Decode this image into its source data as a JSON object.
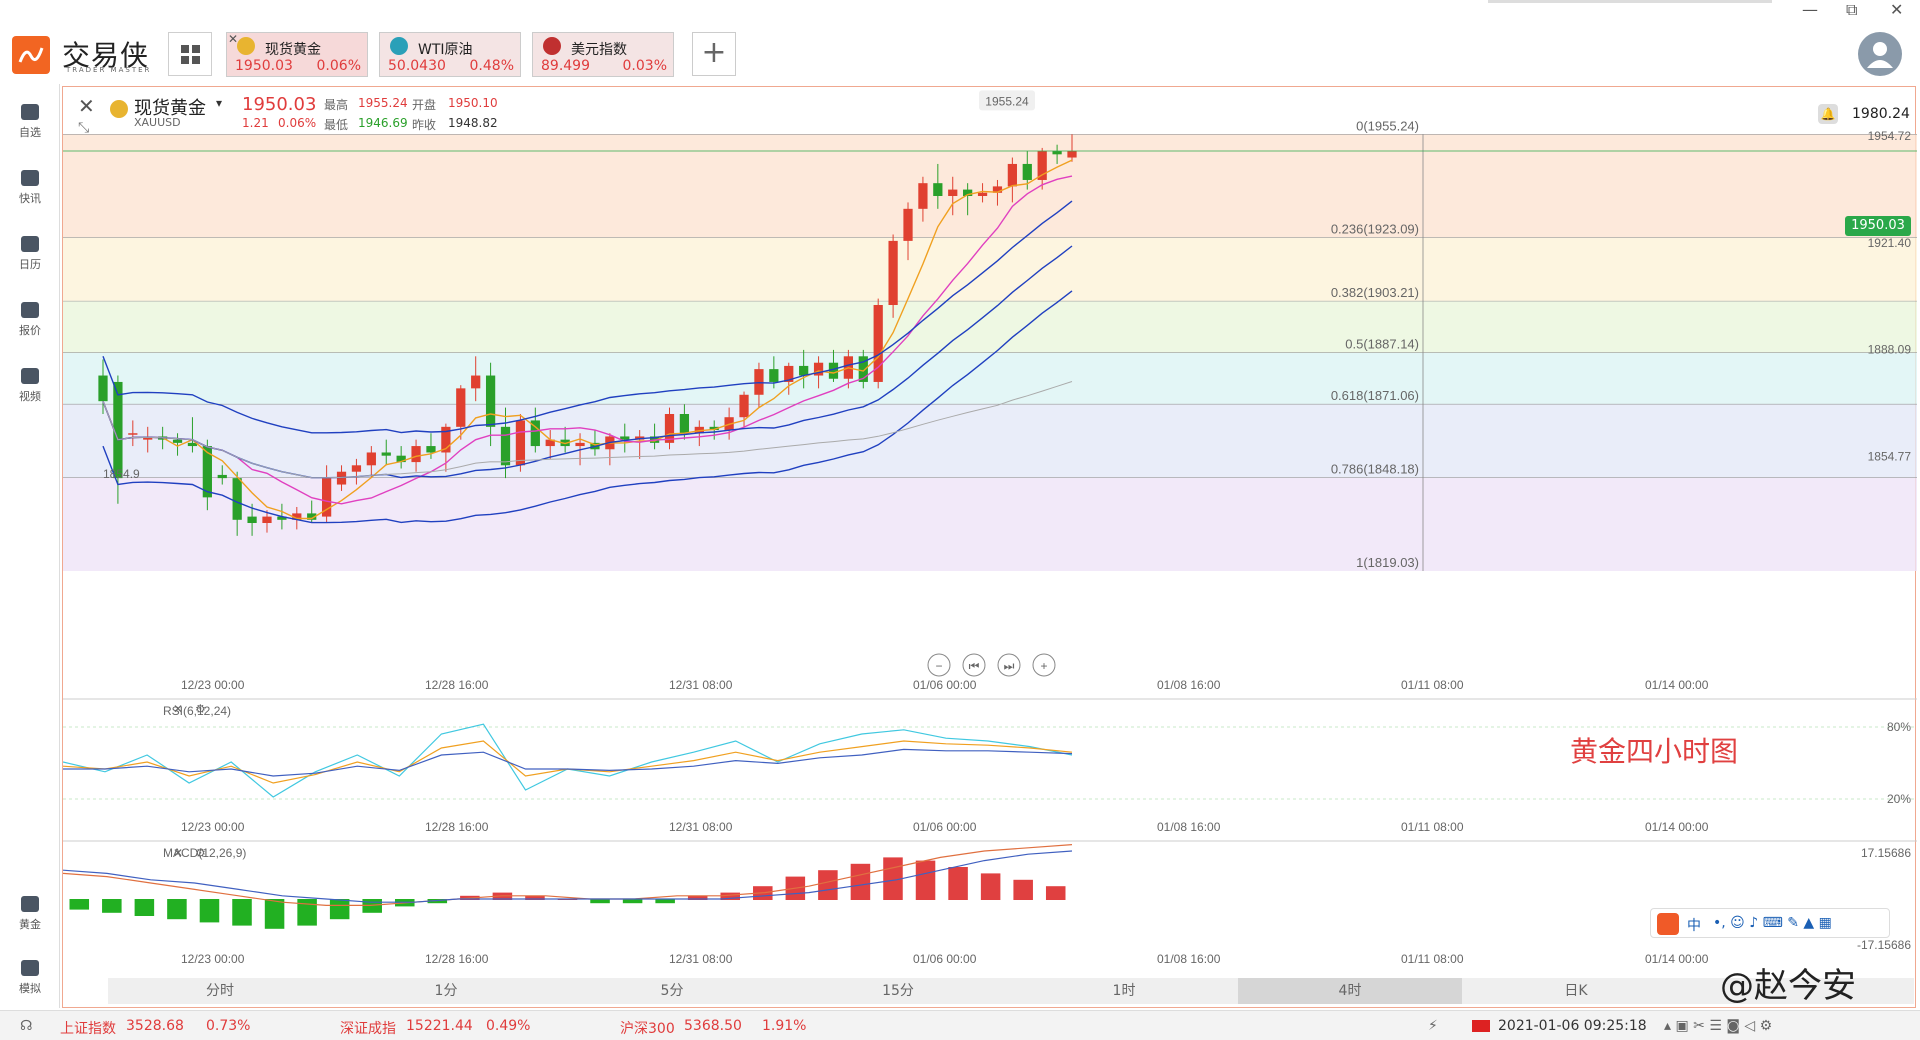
{
  "app": {
    "name": "交易侠",
    "subtitle": "TRADER MASTER"
  },
  "window": {
    "minimize": "—",
    "restore": "⧉",
    "close": "✕"
  },
  "tabs": [
    {
      "name": "现货黄金",
      "price": "1950.03",
      "change": "0.06%",
      "icon_color": "#e8b430",
      "active": true
    },
    {
      "name": "WTI原油",
      "price": "50.0430",
      "change": "0.48%",
      "icon_color": "#2aa0b8",
      "active": false
    },
    {
      "name": "美元指数",
      "price": "89.499",
      "change": "0.03%",
      "icon_color": "#c03030",
      "active": false
    }
  ],
  "add_label": "+",
  "sidebar": [
    {
      "label": "自选",
      "icon": "bookmark-icon"
    },
    {
      "label": "快讯",
      "icon": "news-icon"
    },
    {
      "label": "日历",
      "icon": "calendar-icon"
    },
    {
      "label": "报价",
      "icon": "quote-chart-icon"
    },
    {
      "label": "视频",
      "icon": "video-icon"
    },
    {
      "label": "黄金",
      "icon": "gold-icon"
    },
    {
      "label": "模拟",
      "icon": "simulate-icon"
    }
  ],
  "symbol": {
    "name": "现货黄金",
    "code": "XAUUSD",
    "price": "1950.03",
    "change": "1.21",
    "change_pct": "0.06%",
    "high_label": "最高",
    "high": "1955.24",
    "open_label": "开盘",
    "open": "1950.10",
    "low_label": "最低",
    "low": "1946.69",
    "prev_label": "昨收",
    "prev": "1948.82"
  },
  "alert_price": "1980.24",
  "current_price_tag": "1950.03",
  "peak_label": "1955.24",
  "low_marker": "1854.9",
  "fib": [
    {
      "label": "0(1955.24)",
      "color": "#fde3d2"
    },
    {
      "label": "0.236(1923.09)",
      "color": "#fdf3d8"
    },
    {
      "label": "0.382(1903.21)",
      "color": "#eaf6dc"
    },
    {
      "label": "0.5(1887.14)",
      "color": "#dcf4f4"
    },
    {
      "label": "0.618(1871.06)",
      "color": "#e4e8f8"
    },
    {
      "label": "0.786(1848.18)",
      "color": "#efe4f8"
    },
    {
      "label": "1(1819.03)",
      "color": "#ffffff"
    }
  ],
  "right_axis_main": [
    "1954.72",
    "1921.40",
    "1888.09",
    "1854.77"
  ],
  "x_labels": [
    "12/23 00:00",
    "12/28 16:00",
    "12/31 08:00",
    "01/06 00:00",
    "01/08 16:00",
    "01/11 08:00",
    "01/14 00:00"
  ],
  "rsi": {
    "label": "RSI(6,12,24)",
    "levels": [
      "80%",
      "20%"
    ]
  },
  "macd": {
    "label": "MACD(12,26,9)",
    "top": "17.15686",
    "bottom": "-17.15686"
  },
  "chart_tag": "黄金四小时图",
  "timeframes": [
    "分时",
    "1分",
    "5分",
    "15分",
    "1时",
    "4时",
    "日K"
  ],
  "active_timeframe": "4时",
  "status": [
    {
      "name": "上证指数",
      "value": "3528.68",
      "pct": "0.73%"
    },
    {
      "name": "深证成指",
      "value": "15221.44",
      "pct": "0.49%"
    },
    {
      "name": "沪深300",
      "value": "5368.50",
      "pct": "1.91%"
    }
  ],
  "datetime": "2021-01-06 09:25:18",
  "watermark": "@赵今安",
  "ime_label": "中",
  "chart_data": {
    "type": "candlestick",
    "candles": [
      [
        1880,
        1885,
        1868,
        1872
      ],
      [
        1878,
        1880,
        1840,
        1848
      ],
      [
        1862,
        1866,
        1858,
        1862
      ],
      [
        1860,
        1864,
        1856,
        1861
      ],
      [
        1861,
        1864,
        1857,
        1860
      ],
      [
        1860,
        1862,
        1855,
        1859
      ],
      [
        1859,
        1867,
        1856,
        1858
      ],
      [
        1858,
        1860,
        1838,
        1842
      ],
      [
        1849,
        1852,
        1846,
        1848
      ],
      [
        1848,
        1850,
        1830,
        1835
      ],
      [
        1836,
        1840,
        1830,
        1834
      ],
      [
        1834,
        1838,
        1831,
        1836
      ],
      [
        1836,
        1840,
        1832,
        1835
      ],
      [
        1835,
        1839,
        1832,
        1837
      ],
      [
        1837,
        1841,
        1834,
        1835
      ],
      [
        1836,
        1852,
        1834,
        1848
      ],
      [
        1846,
        1852,
        1844,
        1850
      ],
      [
        1850,
        1854,
        1846,
        1852
      ],
      [
        1852,
        1858,
        1848,
        1856
      ],
      [
        1856,
        1860,
        1852,
        1855
      ],
      [
        1855,
        1858,
        1851,
        1853
      ],
      [
        1853,
        1860,
        1850,
        1858
      ],
      [
        1858,
        1862,
        1854,
        1856
      ],
      [
        1856,
        1865,
        1850,
        1864
      ],
      [
        1864,
        1877,
        1860,
        1876
      ],
      [
        1876,
        1886,
        1872,
        1880
      ],
      [
        1880,
        1884,
        1858,
        1864
      ],
      [
        1864,
        1870,
        1848,
        1852
      ],
      [
        1852,
        1868,
        1850,
        1866
      ],
      [
        1866,
        1870,
        1856,
        1858
      ],
      [
        1858,
        1863,
        1854,
        1860
      ],
      [
        1860,
        1864,
        1856,
        1858
      ],
      [
        1858,
        1862,
        1852,
        1859
      ],
      [
        1859,
        1863,
        1855,
        1857
      ],
      [
        1857,
        1862,
        1852,
        1861
      ],
      [
        1861,
        1865,
        1856,
        1860
      ],
      [
        1860,
        1863,
        1854,
        1861
      ],
      [
        1861,
        1865,
        1857,
        1859
      ],
      [
        1859,
        1870,
        1857,
        1868
      ],
      [
        1868,
        1871,
        1860,
        1862
      ],
      [
        1862,
        1866,
        1858,
        1864
      ],
      [
        1864,
        1866,
        1860,
        1863
      ],
      [
        1863,
        1870,
        1860,
        1867
      ],
      [
        1867,
        1875,
        1864,
        1874
      ],
      [
        1874,
        1884,
        1870,
        1882
      ],
      [
        1882,
        1886,
        1876,
        1878
      ],
      [
        1878,
        1884,
        1874,
        1883
      ],
      [
        1883,
        1888,
        1876,
        1880
      ],
      [
        1880,
        1886,
        1876,
        1884
      ],
      [
        1884,
        1888,
        1878,
        1879
      ],
      [
        1879,
        1888,
        1876,
        1886
      ],
      [
        1886,
        1888,
        1876,
        1878
      ],
      [
        1878,
        1904,
        1876,
        1902
      ],
      [
        1902,
        1924,
        1898,
        1922
      ],
      [
        1922,
        1934,
        1916,
        1932
      ],
      [
        1932,
        1942,
        1928,
        1940
      ],
      [
        1940,
        1946,
        1932,
        1936
      ],
      [
        1936,
        1942,
        1930,
        1938
      ],
      [
        1938,
        1940,
        1930,
        1936
      ],
      [
        1936,
        1940,
        1934,
        1937
      ],
      [
        1937,
        1941,
        1933,
        1939
      ],
      [
        1939,
        1948,
        1934,
        1946
      ],
      [
        1946,
        1950,
        1938,
        1941
      ],
      [
        1941,
        1951,
        1938,
        1950
      ],
      [
        1950,
        1952,
        1946,
        1949
      ],
      [
        1948,
        1955.24,
        1946.69,
        1950.03
      ]
    ],
    "ylim": [
      1819.03,
      1970
    ],
    "rsi": [
      [
        55,
        52,
        50
      ],
      [
        48,
        50,
        50
      ],
      [
        60,
        55,
        52
      ],
      [
        40,
        45,
        48
      ],
      [
        55,
        52,
        50
      ],
      [
        30,
        40,
        45
      ],
      [
        48,
        46,
        47
      ],
      [
        60,
        55,
        52
      ],
      [
        45,
        48,
        49
      ],
      [
        75,
        65,
        60
      ],
      [
        82,
        70,
        62
      ],
      [
        35,
        45,
        50
      ],
      [
        50,
        50,
        50
      ],
      [
        45,
        48,
        49
      ],
      [
        55,
        52,
        50
      ],
      [
        62,
        56,
        52
      ],
      [
        70,
        62,
        56
      ],
      [
        55,
        56,
        54
      ],
      [
        68,
        62,
        58
      ],
      [
        75,
        66,
        60
      ],
      [
        78,
        70,
        64
      ],
      [
        72,
        68,
        63
      ],
      [
        70,
        67,
        63
      ],
      [
        66,
        65,
        62
      ],
      [
        60,
        62,
        61
      ]
    ],
    "macd_hist": [
      -3,
      -4,
      -5,
      -6,
      -7,
      -8,
      -9,
      -8,
      -6,
      -4,
      -2,
      -1,
      1,
      2,
      1,
      0,
      -1,
      -1,
      -1,
      1,
      2,
      4,
      7,
      9,
      11,
      13,
      12,
      10,
      8,
      6,
      4
    ],
    "macd_dif": [
      8,
      7,
      5,
      3,
      1,
      -1,
      -2,
      -2,
      -1,
      0,
      1,
      1,
      0,
      0,
      1,
      1,
      2,
      4,
      7,
      10,
      13,
      15,
      16,
      17
    ],
    "macd_dea": [
      9,
      8,
      6,
      5,
      3,
      1,
      0,
      -1,
      -1,
      0,
      0,
      0,
      0,
      0,
      0,
      0,
      1,
      2,
      4,
      6,
      9,
      12,
      14,
      15
    ]
  }
}
